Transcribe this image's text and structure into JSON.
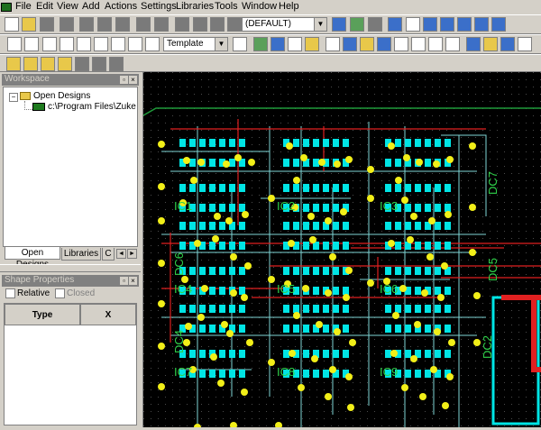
{
  "menu": {
    "items": [
      "File",
      "Edit",
      "View",
      "Add",
      "Actions",
      "Settings",
      "Libraries",
      "Tools",
      "Window",
      "Help"
    ]
  },
  "toolbar": {
    "layer_combo_value": "(DEFAULT)",
    "template_combo_value": "Template"
  },
  "workspace": {
    "title": "Workspace",
    "tree_root": "Open Designs",
    "tree_child": "c:\\Program Files\\Zuken\\",
    "tabs": [
      "Open Designs",
      "Libraries",
      "C"
    ]
  },
  "shape_properties": {
    "title": "Shape Properties",
    "relative_label": "Relative",
    "closed_label": "Closed",
    "col_type": "Type",
    "col_x": "X"
  },
  "board": {
    "labels": [
      "IC1",
      "IC2",
      "IC3",
      "IC4",
      "IC5",
      "IC6",
      "IC7",
      "IC8",
      "IC9",
      "DC4",
      "DC5",
      "DC6",
      "DC7",
      "DC2"
    ],
    "colors": {
      "pad": "#00e5e5",
      "via": "#f2ef18",
      "trace_red": "#e02020",
      "trace_cyan": "#7fd6d6",
      "label": "#2fd24a",
      "outline": "#1f9a3a"
    }
  }
}
